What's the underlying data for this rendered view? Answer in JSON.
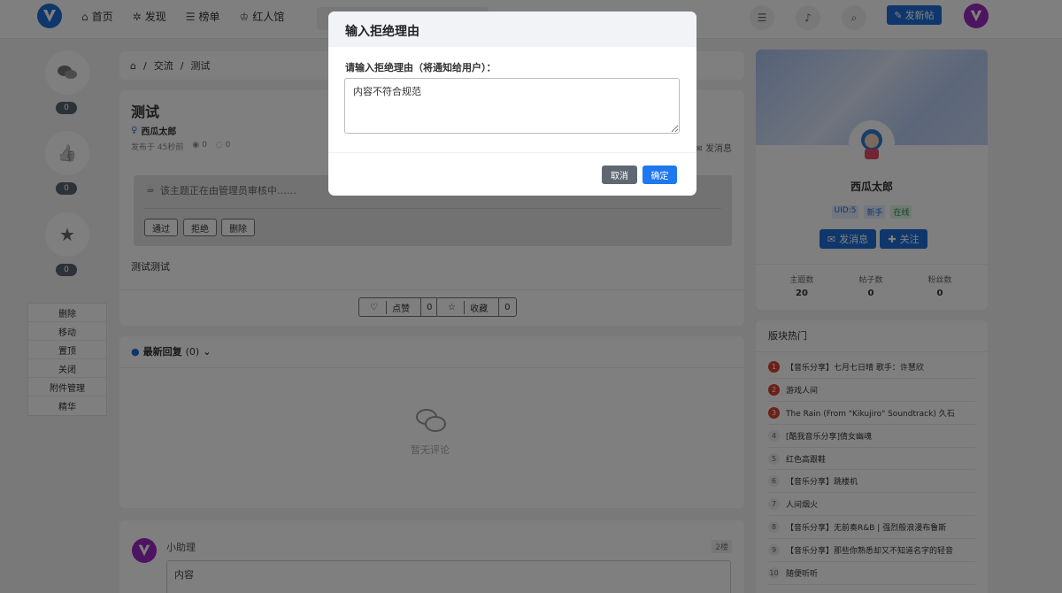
{
  "nav": {
    "items": [
      {
        "icon": "home-icon",
        "glyph": "⌂",
        "label": "首页"
      },
      {
        "icon": "compass-icon",
        "glyph": "✲",
        "label": "发现"
      },
      {
        "icon": "list-icon",
        "glyph": "☰",
        "label": "榜单"
      },
      {
        "icon": "user-badge-icon",
        "glyph": "♔",
        "label": "红人馆"
      }
    ],
    "post_button": "发新帖",
    "post_icon": "✎"
  },
  "rail": {
    "like_glyph": "👍",
    "counts": [
      "0",
      "0",
      "0"
    ],
    "menu": [
      "删除",
      "移动",
      "置顶",
      "关闭",
      "附件管理",
      "精华"
    ]
  },
  "breadcrumb": {
    "home_glyph": "⌂",
    "items": [
      "交流",
      "测试"
    ],
    "sep": "/"
  },
  "post": {
    "title": "测试",
    "author": "西瓜太郎",
    "published": "发布于 45秒前",
    "views": "0",
    "comments": "0",
    "view_glyph": "◉",
    "comment_glyph": "◌",
    "message_link": "发消息",
    "review_text": "该主题正在由管理员审核中……",
    "review_buttons": {
      "pass": "通过",
      "reject": "拒绝",
      "delete": "删除"
    },
    "body": "测试测试",
    "like_label": "点赞",
    "like_count": "0",
    "fav_label": "收藏",
    "fav_count": "0"
  },
  "replies": {
    "title": "最新回复",
    "count": "(0)",
    "empty": "暂无评论"
  },
  "comment": {
    "name": "小助理",
    "floor": "2楼",
    "content": "内容"
  },
  "profile": {
    "name": "西瓜太郎",
    "uid": "UID:5",
    "level": "新手",
    "status": "在线",
    "message_btn": "发消息",
    "follow_btn": "关注",
    "stats": [
      {
        "label": "主题数",
        "value": "20"
      },
      {
        "label": "帖子数",
        "value": "0"
      },
      {
        "label": "粉丝数",
        "value": "0"
      }
    ]
  },
  "hot": {
    "title": "版块热门",
    "items": [
      {
        "n": "1",
        "t": "【音乐分享】七月七日晴 歌手：许慧欣"
      },
      {
        "n": "2",
        "t": "游戏人间"
      },
      {
        "n": "3",
        "t": "The Rain (From \"Kikujiro\" Soundtrack) 久石"
      },
      {
        "n": "4",
        "t": "[酷我音乐分享]倩女幽魂"
      },
      {
        "n": "5",
        "t": "红色高跟鞋"
      },
      {
        "n": "6",
        "t": "【音乐分享】跳楼机"
      },
      {
        "n": "7",
        "t": "人间烟火"
      },
      {
        "n": "8",
        "t": "【音乐分享】无前奏R&B | 强烈般浪漫布鲁斯"
      },
      {
        "n": "9",
        "t": "【音乐分享】那些你熟悉却又不知道名字的轻音"
      },
      {
        "n": "10",
        "t": "随便听听"
      }
    ]
  },
  "modal": {
    "title": "输入拒绝理由",
    "label": "请输入拒绝理由（将通知给用户）：",
    "textarea_value": "内容不符合规范",
    "cancel": "取消",
    "ok": "确定"
  },
  "colors": {
    "primary": "#1e6fd9",
    "confirm": "#1e78f0",
    "cancel": "#5f6772",
    "rank_top": "#d9432e"
  }
}
